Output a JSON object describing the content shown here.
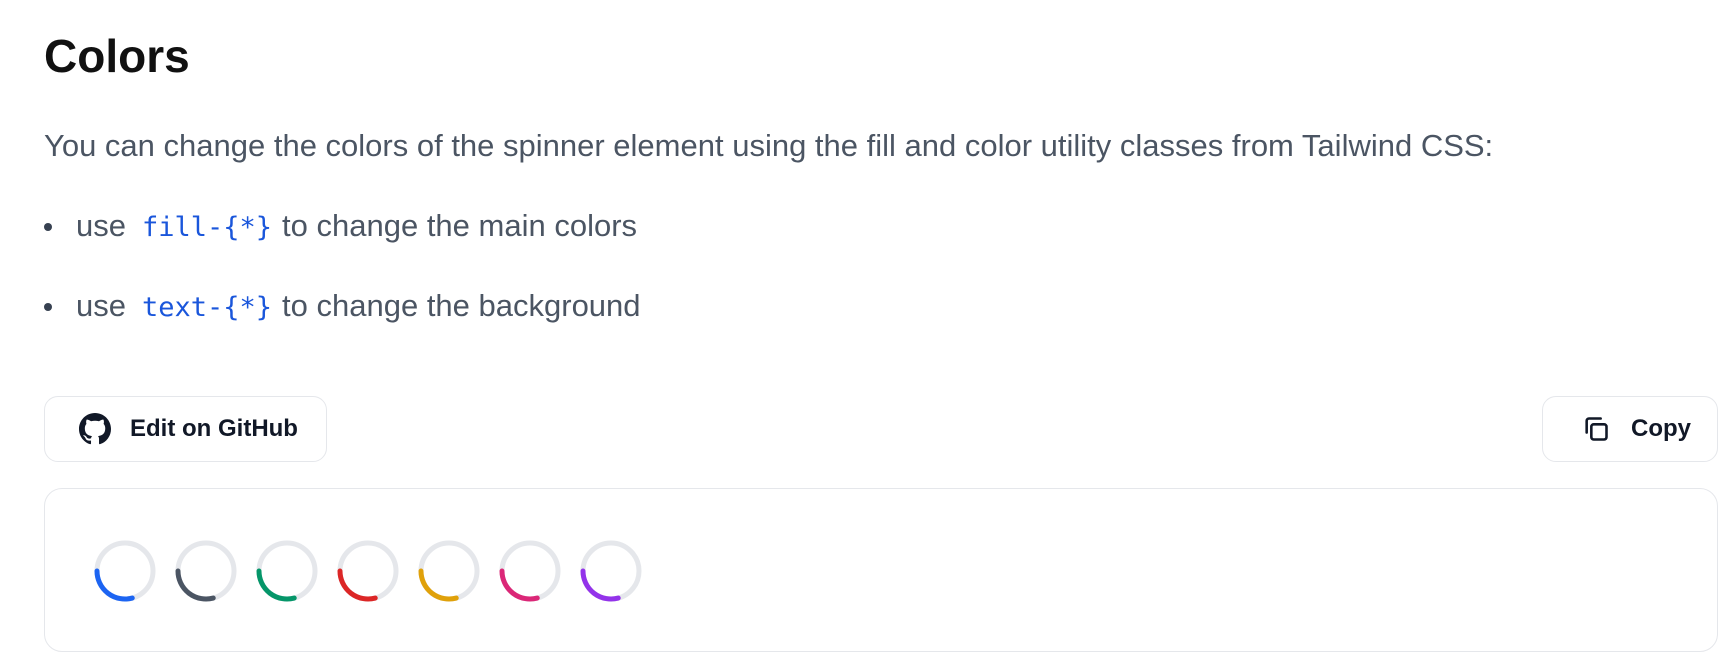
{
  "heading": "Colors",
  "intro": "You can change the colors of the spinner element using the fill and color utility classes from Tailwind CSS:",
  "bullets": [
    {
      "prefix": "use",
      "code": "fill-{*}",
      "suffix": "to change the main colors"
    },
    {
      "prefix": "use",
      "code": "text-{*}",
      "suffix": "to change the background"
    }
  ],
  "toolbar": {
    "github_label": "Edit on GitHub",
    "github_icon": "github-icon",
    "copy_label": "Copy",
    "copy_icon": "copy-icon"
  },
  "preview": {
    "track_color": "#e5e7eb",
    "spinners": [
      {
        "name": "spinner-blue",
        "color": "#1c64f2"
      },
      {
        "name": "spinner-gray",
        "color": "#4b5563"
      },
      {
        "name": "spinner-green",
        "color": "#059669"
      },
      {
        "name": "spinner-red",
        "color": "#dc2626"
      },
      {
        "name": "spinner-yellow",
        "color": "#e0a10a"
      },
      {
        "name": "spinner-pink",
        "color": "#db2777"
      },
      {
        "name": "spinner-purple",
        "color": "#9333ea"
      }
    ]
  }
}
